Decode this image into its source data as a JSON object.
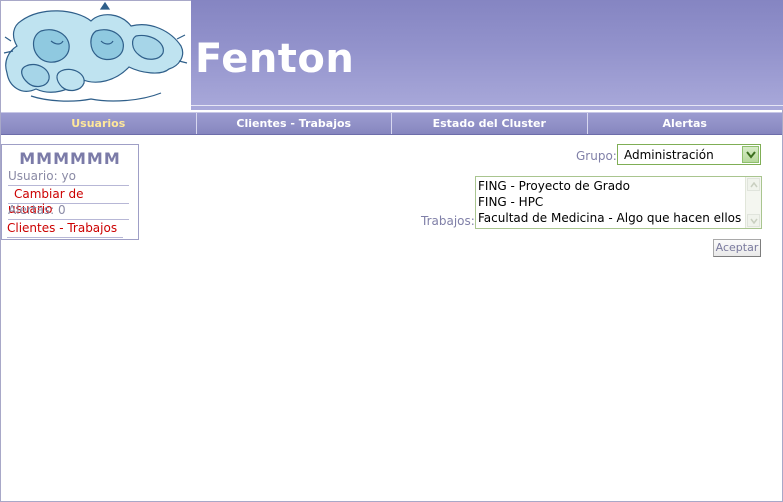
{
  "header": {
    "title": "Fenton"
  },
  "nav": {
    "items": [
      {
        "label": "Usuarios"
      },
      {
        "label": "Clientes - Trabajos"
      },
      {
        "label": "Estado del Cluster"
      },
      {
        "label": "Alertas"
      }
    ],
    "active": "Usuarios"
  },
  "userbox": {
    "name": "MMMMMM",
    "usuario": "Usuario: yo",
    "cambiar": "Cambiar de usuario",
    "alertas": "Alertas: 0",
    "clientes": "Clientes - Trabajos"
  },
  "form": {
    "grupo_label": "Grupo:",
    "grupo_value": "Administración",
    "trabajos_label": "Trabajos:",
    "trabajos": [
      "FING - Proyecto de Grado",
      "FING - HPC",
      "Facultad de Medicina - Algo que hacen ellos"
    ],
    "aceptar": "Aceptar"
  },
  "colors": {
    "header": "#9393cc",
    "nav": "#8c8cc4",
    "nav_active_text": "#ffe89a",
    "link": "#cc0000",
    "label": "#8080a8"
  },
  "icons": [
    "logo-image",
    "chevron-down-icon",
    "scroll-up-icon",
    "scroll-down-icon"
  ]
}
